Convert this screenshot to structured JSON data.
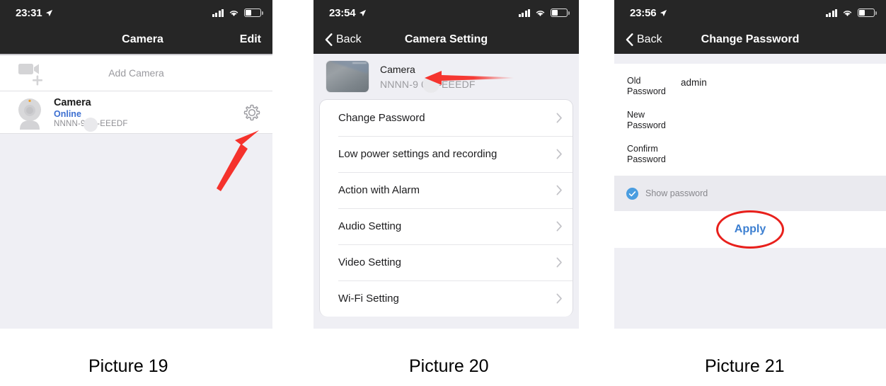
{
  "panels": [
    {
      "id": "camera-list",
      "status_bar": {
        "time": "23:31",
        "location_icon": "location-arrow-icon",
        "signal_icon": "cellular-signal-icon",
        "wifi_icon": "wifi-icon",
        "battery_icon": "battery-icon"
      },
      "nav": {
        "title": "Camera",
        "right_action": "Edit"
      },
      "add_row": {
        "icon": "video-camera-add-icon",
        "label": "Add Camera"
      },
      "camera": {
        "icon": "webcam-icon",
        "name": "Camera",
        "status": "Online",
        "uid": "NNNN-9      39-EEEDF",
        "gear_icon": "gear-icon"
      },
      "annotation_icon": "red-arrow-up-right",
      "caption": "Picture 19"
    },
    {
      "id": "camera-setting",
      "status_bar": {
        "time": "23:54",
        "location_icon": "location-arrow-icon",
        "signal_icon": "cellular-signal-icon",
        "wifi_icon": "wifi-icon",
        "battery_icon": "battery-icon"
      },
      "nav": {
        "back": "Back",
        "title": "Camera Setting",
        "back_icon": "chevron-left-icon"
      },
      "header": {
        "thumbnail_icon": "camera-snapshot-thumbnail",
        "name": "Camera",
        "uid": "NNNN-9     099-EEEDF"
      },
      "menu": [
        {
          "label": "Change Password",
          "chevron": "chevron-right-icon"
        },
        {
          "label": "Low power settings and recording",
          "chevron": "chevron-right-icon"
        },
        {
          "label": "Action with Alarm",
          "chevron": "chevron-right-icon"
        },
        {
          "label": "Audio Setting",
          "chevron": "chevron-right-icon"
        },
        {
          "label": "Video Setting",
          "chevron": "chevron-right-icon"
        },
        {
          "label": "Wi-Fi Setting",
          "chevron": "chevron-right-icon"
        }
      ],
      "annotation_icon": "red-arrow-left",
      "caption": "Picture 20"
    },
    {
      "id": "change-password",
      "status_bar": {
        "time": "23:56",
        "location_icon": "location-arrow-icon",
        "signal_icon": "cellular-signal-icon",
        "wifi_icon": "wifi-icon",
        "battery_icon": "battery-icon"
      },
      "nav": {
        "back": "Back",
        "title": "Change Password",
        "back_icon": "chevron-left-icon"
      },
      "fields": [
        {
          "label": "Old\nPassword",
          "label_line1": "Old",
          "label_line2": "Password",
          "value": "admin"
        },
        {
          "label": "New\nPassword",
          "label_line1": "New",
          "label_line2": "Password",
          "value": ""
        },
        {
          "label": "Confirm\nPassword",
          "label_line1": "Confirm",
          "label_line2": "Password",
          "value": ""
        }
      ],
      "show_password": {
        "label": "Show password",
        "checked": true,
        "icon": "check-circle-icon"
      },
      "apply": {
        "label": "Apply"
      },
      "annotation_icon": "red-ellipse-highlight",
      "caption": "Picture 21"
    }
  ],
  "colors": {
    "nav_bar": "#262626",
    "page_background": "#efeff4",
    "accent_blue": "#3c7fd1",
    "status_online": "#3c6fd1",
    "annotation_red": "#e8201c",
    "check_blue": "#4a9de0"
  }
}
